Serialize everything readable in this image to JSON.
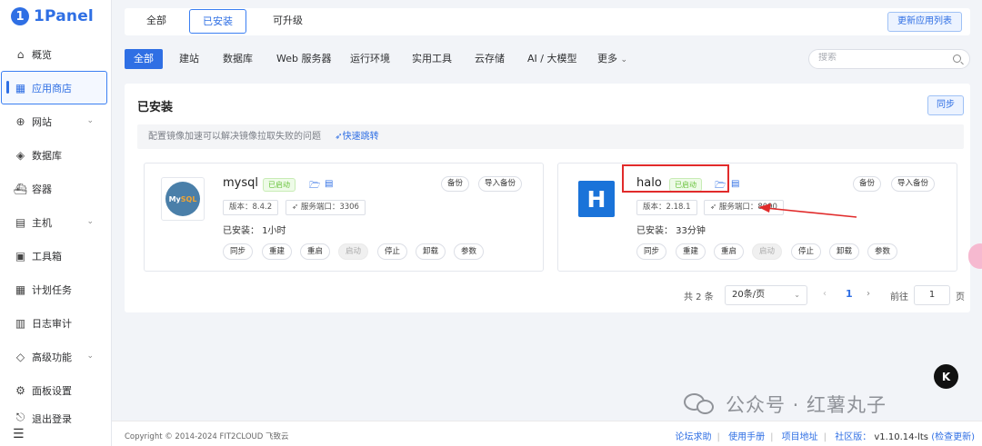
{
  "sidebar": {
    "logo_text": "1Panel",
    "items": [
      {
        "label": "概览",
        "icon": "home-icon",
        "glyph": "⌂"
      },
      {
        "label": "应用商店",
        "icon": "grid-icon",
        "glyph": "▦"
      },
      {
        "label": "网站",
        "icon": "globe-icon",
        "glyph": "⊕"
      },
      {
        "label": "数据库",
        "icon": "layers-icon",
        "glyph": "◈"
      },
      {
        "label": "容器",
        "icon": "docker-icon",
        "glyph": "⛴"
      },
      {
        "label": "主机",
        "icon": "server-icon",
        "glyph": "▤"
      },
      {
        "label": "工具箱",
        "icon": "toolbox-icon",
        "glyph": "▣"
      },
      {
        "label": "计划任务",
        "icon": "calendar-icon",
        "glyph": "▦"
      },
      {
        "label": "日志审计",
        "icon": "log-icon",
        "glyph": "▥"
      },
      {
        "label": "高级功能",
        "icon": "diamond-icon",
        "glyph": "◇"
      },
      {
        "label": "面板设置",
        "icon": "gear-icon",
        "glyph": "⚙"
      },
      {
        "label": "退出登录",
        "icon": "logout-icon",
        "glyph": "⎋"
      }
    ]
  },
  "top_tabs": [
    "全部",
    "已安装",
    "可升级"
  ],
  "update_list_label": "更新应用列表",
  "categories": [
    "全部",
    "建站",
    "数据库",
    "Web 服务器",
    "运行环境",
    "实用工具",
    "云存储",
    "AI / 大模型",
    "更多"
  ],
  "search": {
    "placeholder": "搜索"
  },
  "panel": {
    "title": "已安装",
    "sync_label": "同步",
    "notice": "配置镜像加速可以解决镜像拉取失败的问题",
    "notice_link": "快速跳转"
  },
  "apps": [
    {
      "name": "mysql",
      "status": "已启动",
      "version": "版本：8.4.2",
      "port": "服务端口：3306",
      "installed": "已安装：  1小时",
      "backup_label": "备份",
      "import_label": "导入备份",
      "logo_text_a": "My",
      "logo_text_b": "SQL",
      "ops": [
        "同步",
        "重建",
        "重启",
        "启动",
        "停止",
        "卸载",
        "参数"
      ]
    },
    {
      "name": "halo",
      "status": "已启动",
      "version": "版本：2.18.1",
      "port": "服务端口：8090",
      "installed": "已安装：  33分钟",
      "backup_label": "备份",
      "import_label": "导入备份",
      "logo_text": "H",
      "ops": [
        "同步",
        "重建",
        "重启",
        "启动",
        "停止",
        "卸载",
        "参数"
      ]
    }
  ],
  "pagination": {
    "total": "共 2 条",
    "page_size": "20条/页",
    "current": "1",
    "goto_label": "前往",
    "goto_value": "1",
    "page_unit": "页"
  },
  "footer": {
    "copyright": "Copyright © 2014-2024 FIT2CLOUD 飞致云",
    "links": [
      "论坛求助",
      "使用手册",
      "项目地址"
    ],
    "community": "社区版：",
    "version": "v1.10.14-lts",
    "check_update": "(检查更新)"
  },
  "watermark": "公众号 · 红薯丸子",
  "float_badge": "K",
  "colors": {
    "accent": "#2f6fe4",
    "success": "#67c23a",
    "highlight": "#e12b2b"
  }
}
